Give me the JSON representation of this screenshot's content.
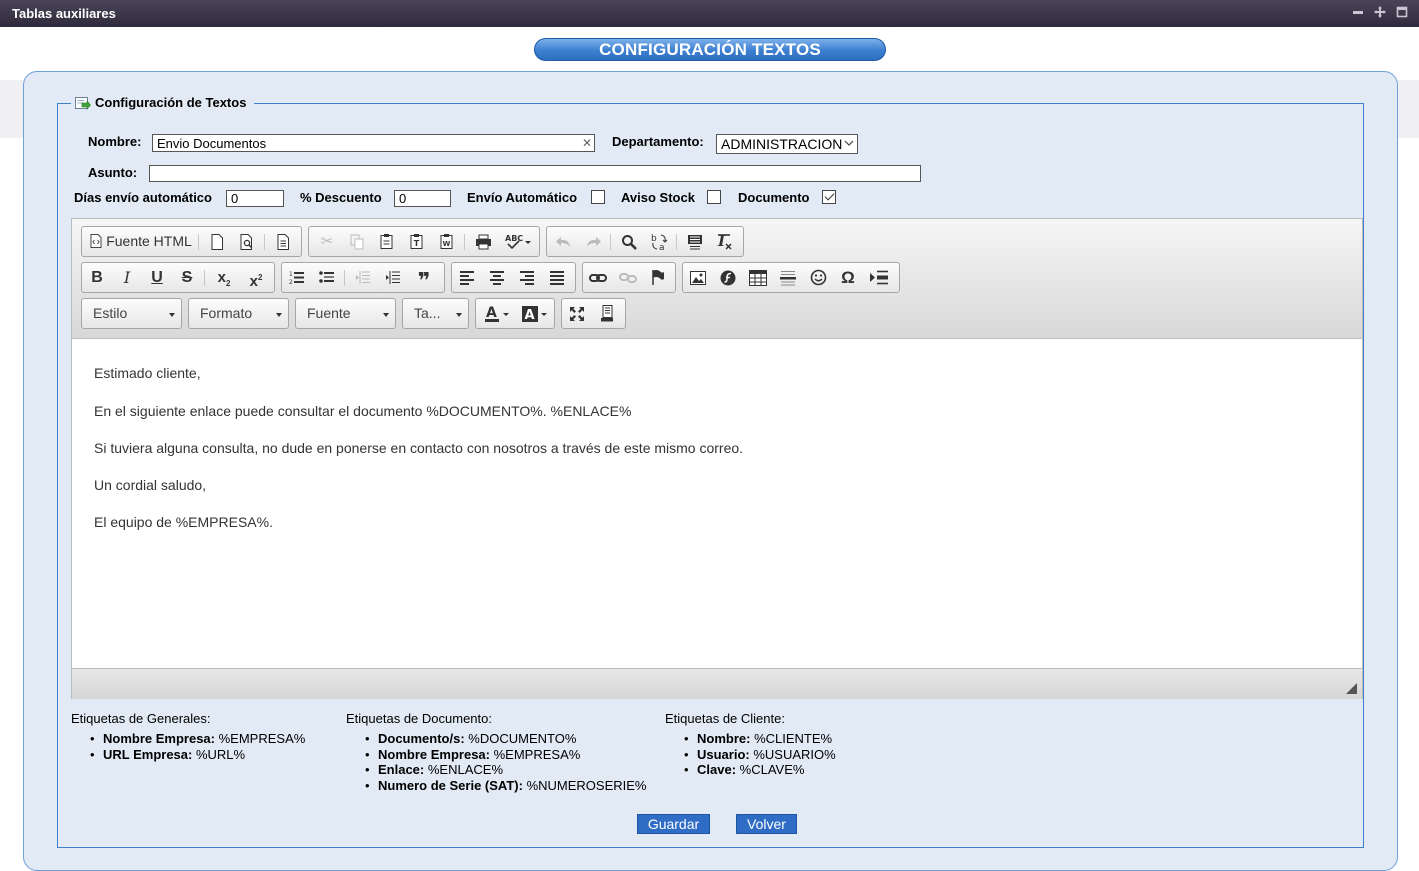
{
  "window": {
    "title": "Tablas auxiliares"
  },
  "header": {
    "title": "CONFIGURACIÓN TEXTOS"
  },
  "form": {
    "legend": "Configuración de Textos",
    "nombre_label": "Nombre:",
    "nombre_value": "Envio Documentos",
    "departamento_label": "Departamento:",
    "departamento_value": "ADMINISTRACION",
    "asunto_label": "Asunto:",
    "asunto_value": "",
    "dias_label": "Días envío automático",
    "dias_value": "0",
    "descuento_label": "% Descuento",
    "descuento_value": "0",
    "envio_label": "Envío Automático",
    "envio_checked": false,
    "aviso_label": "Aviso Stock",
    "aviso_checked": false,
    "documento_label": "Documento",
    "documento_checked": true
  },
  "toolbar": {
    "source_label": "Fuente HTML",
    "combos": {
      "estilo": "Estilo",
      "formato": "Formato",
      "fuente": "Fuente",
      "tamano": "Ta..."
    }
  },
  "editor": {
    "paragraphs": [
      "Estimado cliente,",
      "En el siguiente enlace puede consultar el documento %DOCUMENTO%. %ENLACE%",
      "Si tuviera alguna consulta, no dude en ponerse en contacto con nosotros a través de este mismo correo.",
      "Un cordial saludo,",
      "El equipo de %EMPRESA%."
    ]
  },
  "tags": {
    "generales": {
      "title": "Etiquetas de Generales:",
      "items": [
        {
          "label": "Nombre Empresa:",
          "value": "%EMPRESA%"
        },
        {
          "label": "URL Empresa:",
          "value": "%URL%"
        }
      ]
    },
    "documento": {
      "title": "Etiquetas de Documento:",
      "items": [
        {
          "label": "Documento/s:",
          "value": "%DOCUMENTO%"
        },
        {
          "label": "Nombre Empresa:",
          "value": "%EMPRESA%"
        },
        {
          "label": "Enlace:",
          "value": "%ENLACE%"
        },
        {
          "label": "Numero de Serie (SAT):",
          "value": "%NUMEROSERIE%"
        }
      ]
    },
    "cliente": {
      "title": "Etiquetas de Cliente:",
      "items": [
        {
          "label": "Nombre:",
          "value": "%CLIENTE%"
        },
        {
          "label": "Usuario:",
          "value": "%USUARIO%"
        },
        {
          "label": "Clave:",
          "value": "%CLAVE%"
        }
      ]
    }
  },
  "actions": {
    "save": "Guardar",
    "back": "Volver"
  },
  "colors": {
    "accent": "#2f6cc5",
    "panel": "#e1eaf5",
    "titlebar": "#3a3448"
  }
}
